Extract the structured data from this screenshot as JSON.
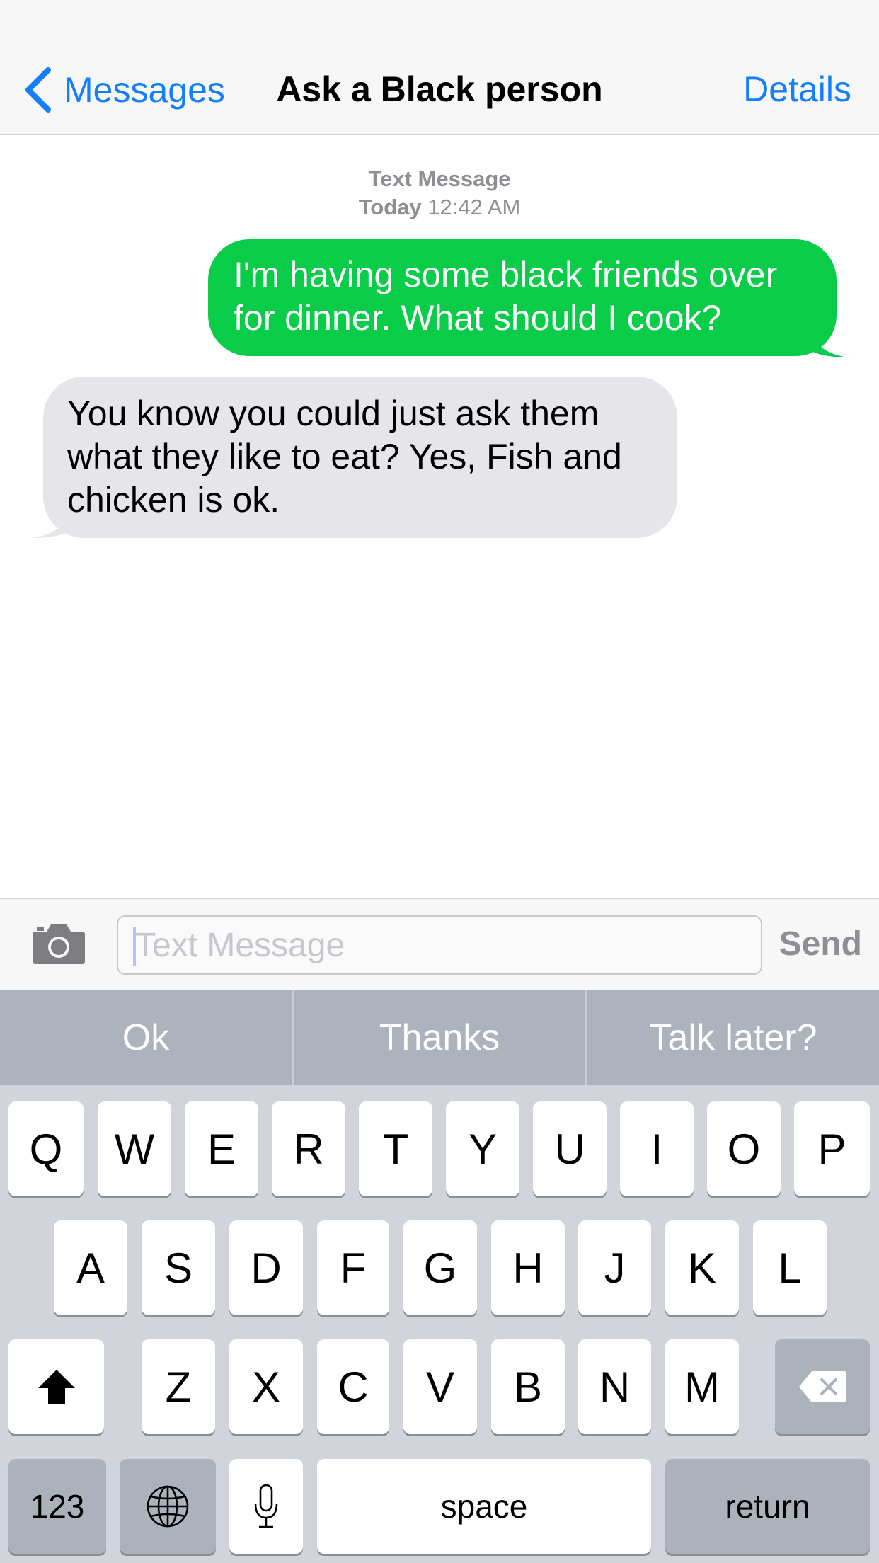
{
  "navbar": {
    "back_label": "Messages",
    "title": "Ask a Black person",
    "details_label": "Details"
  },
  "thread": {
    "service": "Text Message",
    "day": "Today",
    "time": "12:42 AM",
    "messages": [
      {
        "direction": "outgoing",
        "text": "I'm having some black friends over for dinner. What should I cook?"
      },
      {
        "direction": "incoming",
        "text": "You know you could just ask them what they like to eat? Yes, Fish and chicken is ok."
      }
    ]
  },
  "input": {
    "placeholder": "Text Message",
    "value": "",
    "send_label": "Send"
  },
  "predictions": [
    "Ok",
    "Thanks",
    "Talk later?"
  ],
  "keyboard": {
    "row1": [
      "Q",
      "W",
      "E",
      "R",
      "T",
      "Y",
      "U",
      "I",
      "O",
      "P"
    ],
    "row2": [
      "A",
      "S",
      "D",
      "F",
      "G",
      "H",
      "J",
      "K",
      "L"
    ],
    "row3": [
      "Z",
      "X",
      "C",
      "V",
      "B",
      "N",
      "M"
    ],
    "numbers_label": "123",
    "space_label": "space",
    "return_label": "return",
    "icons": {
      "shift": "shift-icon",
      "delete": "delete-icon",
      "globe": "globe-icon",
      "mic": "microphone-icon",
      "camera": "camera-icon",
      "back": "chevron-left-icon"
    }
  },
  "colors": {
    "accent": "#147efb",
    "outgoing_bubble": "#09cd49",
    "incoming_bubble": "#e5e5ea",
    "keyboard_bg": "#d1d5db",
    "prediction_bar": "#acb3bc"
  }
}
